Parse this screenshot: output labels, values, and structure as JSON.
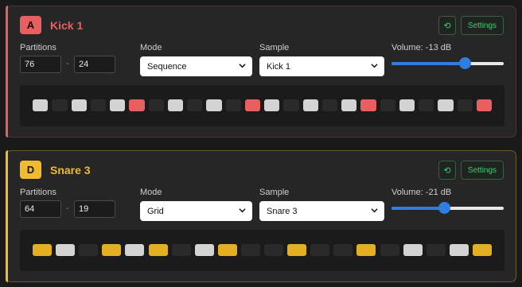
{
  "tracks": [
    {
      "letter": "A",
      "name": "Kick 1",
      "accent": "#e85f5f",
      "settings_label": "Settings",
      "refresh_icon": "refresh-icon",
      "partitions_label": "Partitions",
      "partition_a": "76",
      "partition_b": "24",
      "dash": "-",
      "mode_label": "Mode",
      "mode_value": "Sequence",
      "sample_label": "Sample",
      "sample_value": "Kick 1",
      "volume_label": "Volume: -13 dB",
      "volume_fraction": 0.65,
      "steps": [
        "w",
        "d",
        "w",
        "d",
        "w",
        "r",
        "d",
        "w",
        "d",
        "w",
        "d",
        "r",
        "w",
        "d",
        "w",
        "d",
        "w",
        "r",
        "d",
        "w",
        "d",
        "w",
        "d",
        "r"
      ]
    },
    {
      "letter": "D",
      "name": "Snare 3",
      "accent": "#f0bb2e",
      "settings_label": "Settings",
      "refresh_icon": "refresh-icon",
      "partitions_label": "Partitions",
      "partition_a": "64",
      "partition_b": "19",
      "dash": "-",
      "mode_label": "Mode",
      "mode_value": "Grid",
      "sample_label": "Sample",
      "sample_value": "Snare 3",
      "volume_label": "Volume: -21 dB",
      "volume_fraction": 0.47,
      "steps": [
        "y",
        "w",
        "d",
        "y",
        "w",
        "y",
        "d",
        "w",
        "y",
        "d",
        "d",
        "y",
        "d",
        "d",
        "y",
        "d",
        "w",
        "d",
        "w",
        "y"
      ]
    }
  ]
}
